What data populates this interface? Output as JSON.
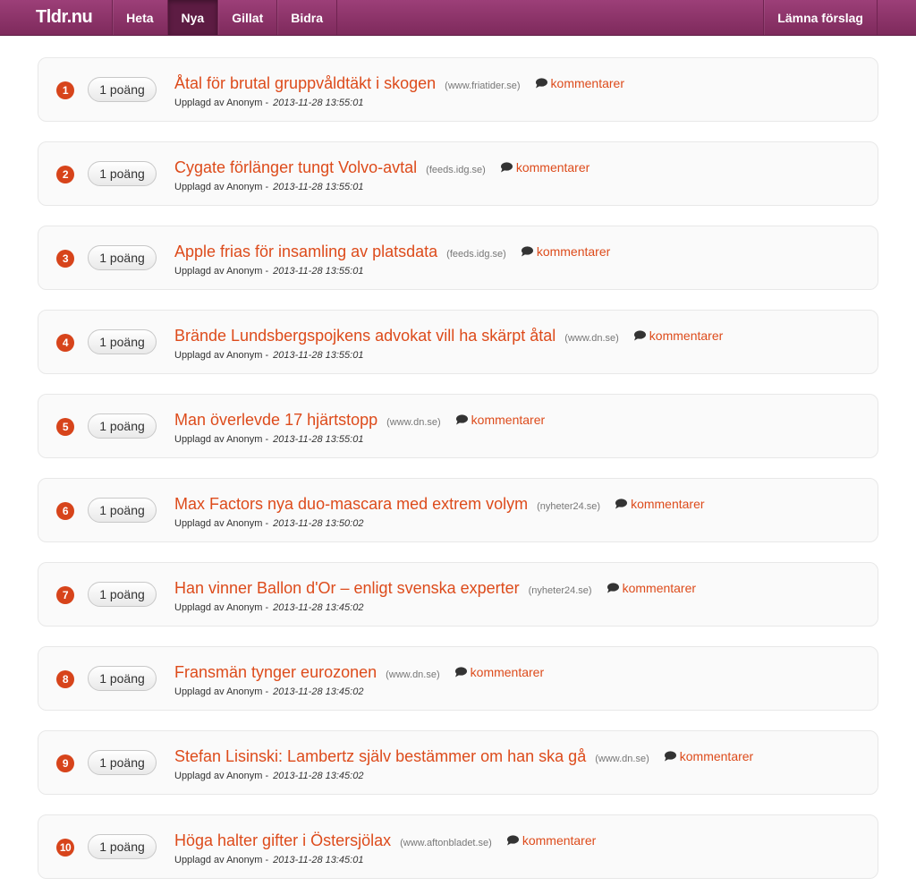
{
  "nav": {
    "brand": "Tldr.nu",
    "tabs": [
      {
        "label": "Heta"
      },
      {
        "label": "Nya"
      },
      {
        "label": "Gillat"
      },
      {
        "label": "Bidra"
      }
    ],
    "right": "Lämna förslag"
  },
  "items": [
    {
      "rank": "1",
      "points": "1 poäng",
      "title": "Åtal för brutal gruppvåldtäkt i skogen",
      "domain": "(www.friatider.se)",
      "comments": "kommentarer",
      "uploaded": "Upplagd av Anonym",
      "sep": "-",
      "time": "2013-11-28 13:55:01"
    },
    {
      "rank": "2",
      "points": "1 poäng",
      "title": "Cygate förlänger tungt Volvo-avtal",
      "domain": "(feeds.idg.se)",
      "comments": "kommentarer",
      "uploaded": "Upplagd av Anonym",
      "sep": "-",
      "time": "2013-11-28 13:55:01"
    },
    {
      "rank": "3",
      "points": "1 poäng",
      "title": "Apple frias för insamling av platsdata",
      "domain": "(feeds.idg.se)",
      "comments": "kommentarer",
      "uploaded": "Upplagd av Anonym",
      "sep": "-",
      "time": "2013-11-28 13:55:01"
    },
    {
      "rank": "4",
      "points": "1 poäng",
      "title": "Brände Lundsbergspojkens advokat vill ha skärpt åtal",
      "domain": "(www.dn.se)",
      "comments": "kommentarer",
      "uploaded": "Upplagd av Anonym",
      "sep": "-",
      "time": "2013-11-28 13:55:01"
    },
    {
      "rank": "5",
      "points": "1 poäng",
      "title": "Man överlevde 17 hjärtstopp",
      "domain": "(www.dn.se)",
      "comments": "kommentarer",
      "uploaded": "Upplagd av Anonym",
      "sep": "-",
      "time": "2013-11-28 13:55:01"
    },
    {
      "rank": "6",
      "points": "1 poäng",
      "title": "Max Factors nya duo-mascara med extrem volym",
      "domain": "(nyheter24.se)",
      "comments": "kommentarer",
      "uploaded": "Upplagd av Anonym",
      "sep": "-",
      "time": "2013-11-28 13:50:02"
    },
    {
      "rank": "7",
      "points": "1 poäng",
      "title": "Han vinner Ballon d'Or – enligt svenska experter",
      "domain": "(nyheter24.se)",
      "comments": "kommentarer",
      "uploaded": "Upplagd av Anonym",
      "sep": "-",
      "time": "2013-11-28 13:45:02"
    },
    {
      "rank": "8",
      "points": "1 poäng",
      "title": "Fransmän tynger eurozonen",
      "domain": "(www.dn.se)",
      "comments": "kommentarer",
      "uploaded": "Upplagd av Anonym",
      "sep": "-",
      "time": "2013-11-28 13:45:02"
    },
    {
      "rank": "9",
      "points": "1 poäng",
      "title": "Stefan Lisinski: Lambertz själv bestämmer om han ska gå",
      "domain": "(www.dn.se)",
      "comments": "kommentarer",
      "uploaded": "Upplagd av Anonym",
      "sep": "-",
      "time": "2013-11-28 13:45:02"
    },
    {
      "rank": "10",
      "points": "1 poäng",
      "title": "Höga halter gifter i Östersjölax",
      "domain": "(www.aftonbladet.se)",
      "comments": "kommentarer",
      "uploaded": "Upplagd av Anonym",
      "sep": "-",
      "time": "2013-11-28 13:45:01"
    }
  ],
  "colors": {
    "accent": "#dd4b1b",
    "nav": "#8c3468",
    "rank": "#d7441b"
  },
  "icons": {
    "comment": "speech-bubble-icon"
  }
}
